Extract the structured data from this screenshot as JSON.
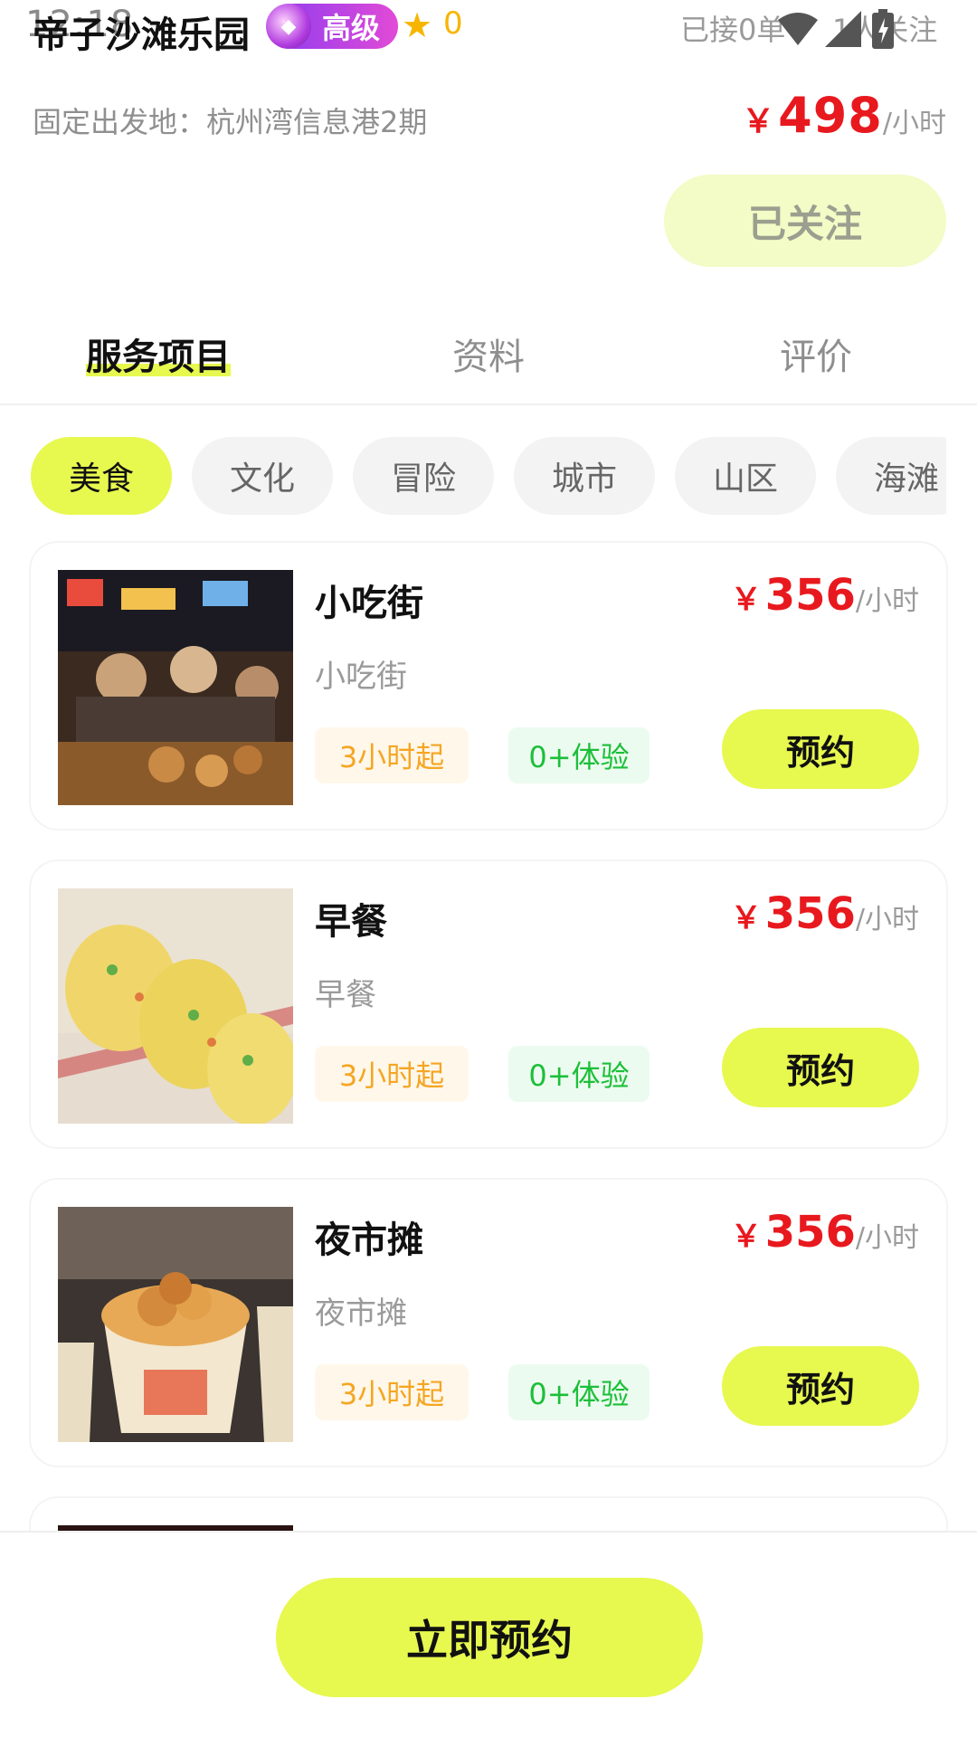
{
  "status": {
    "time": "12:18"
  },
  "header": {
    "name": "帝子沙滩乐园",
    "level_label": "高级",
    "star_count": "0",
    "orders": "已接0单",
    "followers": "1人关注",
    "origin": "固定出发地：杭州湾信息港2期",
    "price_currency": "￥",
    "price_value": "498",
    "price_unit": "/小时",
    "follow_label": "已关注"
  },
  "tabs": [
    {
      "label": "服务项目"
    },
    {
      "label": "资料"
    },
    {
      "label": "评价"
    }
  ],
  "categories": [
    {
      "label": "美食"
    },
    {
      "label": "文化"
    },
    {
      "label": "冒险"
    },
    {
      "label": "城市"
    },
    {
      "label": "山区"
    },
    {
      "label": "海滩"
    }
  ],
  "services": [
    {
      "title": "小吃街",
      "subtitle": "小吃街",
      "duration": "3小时起",
      "experience": "0+体验",
      "currency": "￥",
      "price": "356",
      "unit": "/小时",
      "book_label": "预约"
    },
    {
      "title": "早餐",
      "subtitle": "早餐",
      "duration": "3小时起",
      "experience": "0+体验",
      "currency": "￥",
      "price": "356",
      "unit": "/小时",
      "book_label": "预约"
    },
    {
      "title": "夜市摊",
      "subtitle": "夜市摊",
      "duration": "3小时起",
      "experience": "0+体验",
      "currency": "￥",
      "price": "356",
      "unit": "/小时",
      "book_label": "预约"
    }
  ],
  "bottom": {
    "book_now_label": "立即预约"
  },
  "colors": {
    "accent": "#e7f84f",
    "price": "#e8191e",
    "orange": "#f5a623",
    "green": "#1cbf3a"
  },
  "icons": [
    "wifi-icon",
    "signal-icon",
    "battery-icon",
    "star-icon",
    "level-gem-icon"
  ]
}
